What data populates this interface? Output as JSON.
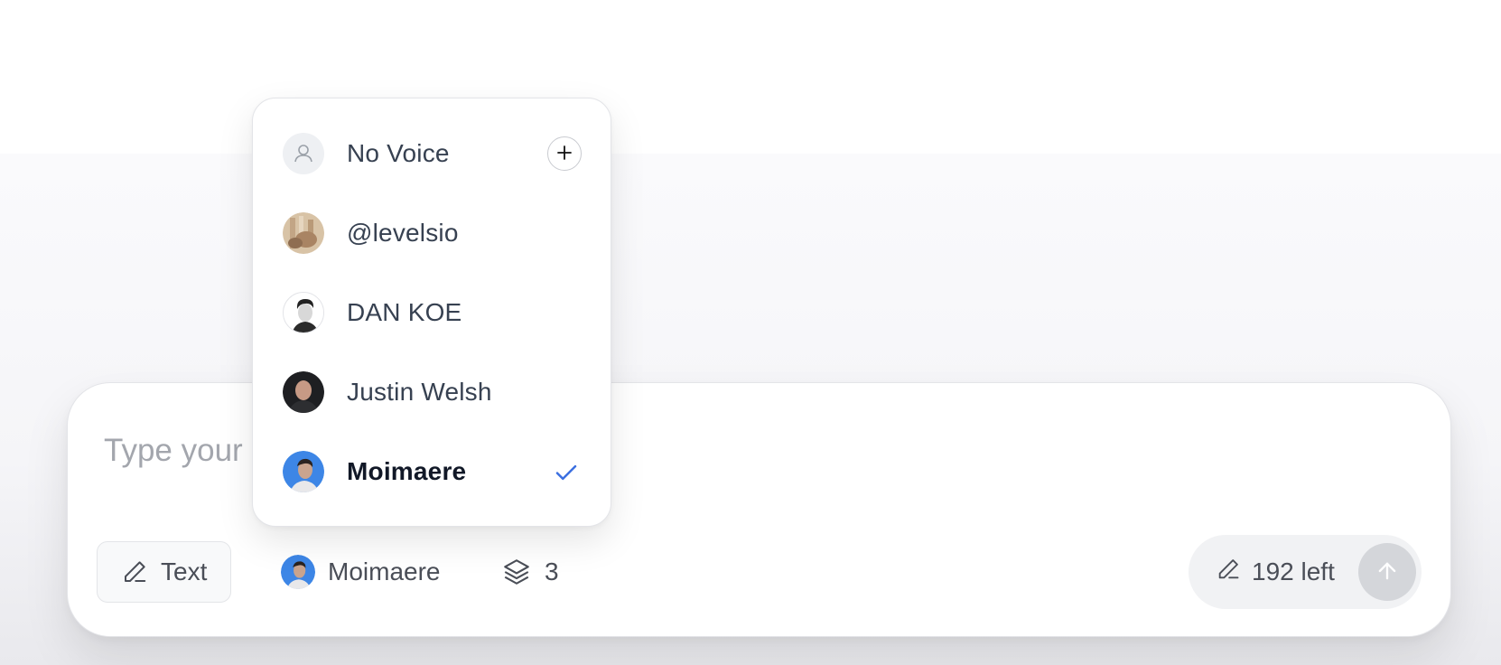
{
  "composer": {
    "placeholder": "Type your",
    "mode_chip": {
      "label": "Text",
      "icon": "pencil-icon"
    },
    "voice_chip": {
      "label": "Moimaere",
      "avatar": "moimaere-avatar"
    },
    "layers_chip": {
      "count": "3",
      "icon": "layers-icon"
    },
    "counter": {
      "label": "192 left",
      "icon": "pencil-icon"
    },
    "send": {
      "icon": "arrow-up-icon"
    }
  },
  "voice_menu": {
    "items": [
      {
        "label": "No Voice",
        "avatar": "person-icon",
        "action": "add",
        "selected": false
      },
      {
        "label": "@levelsio",
        "avatar": "levelsio-avatar",
        "selected": false
      },
      {
        "label": "DAN KOE",
        "avatar": "dan-koe-avatar",
        "selected": false
      },
      {
        "label": "Justin Welsh",
        "avatar": "justin-welsh-avatar",
        "selected": false
      },
      {
        "label": "Moimaere",
        "avatar": "moimaere-avatar",
        "selected": true
      }
    ]
  },
  "colors": {
    "accent": "#3b6fe0",
    "send_disabled": "#d4d6da",
    "placeholder": "#a3a6ad",
    "text": "#374151"
  }
}
